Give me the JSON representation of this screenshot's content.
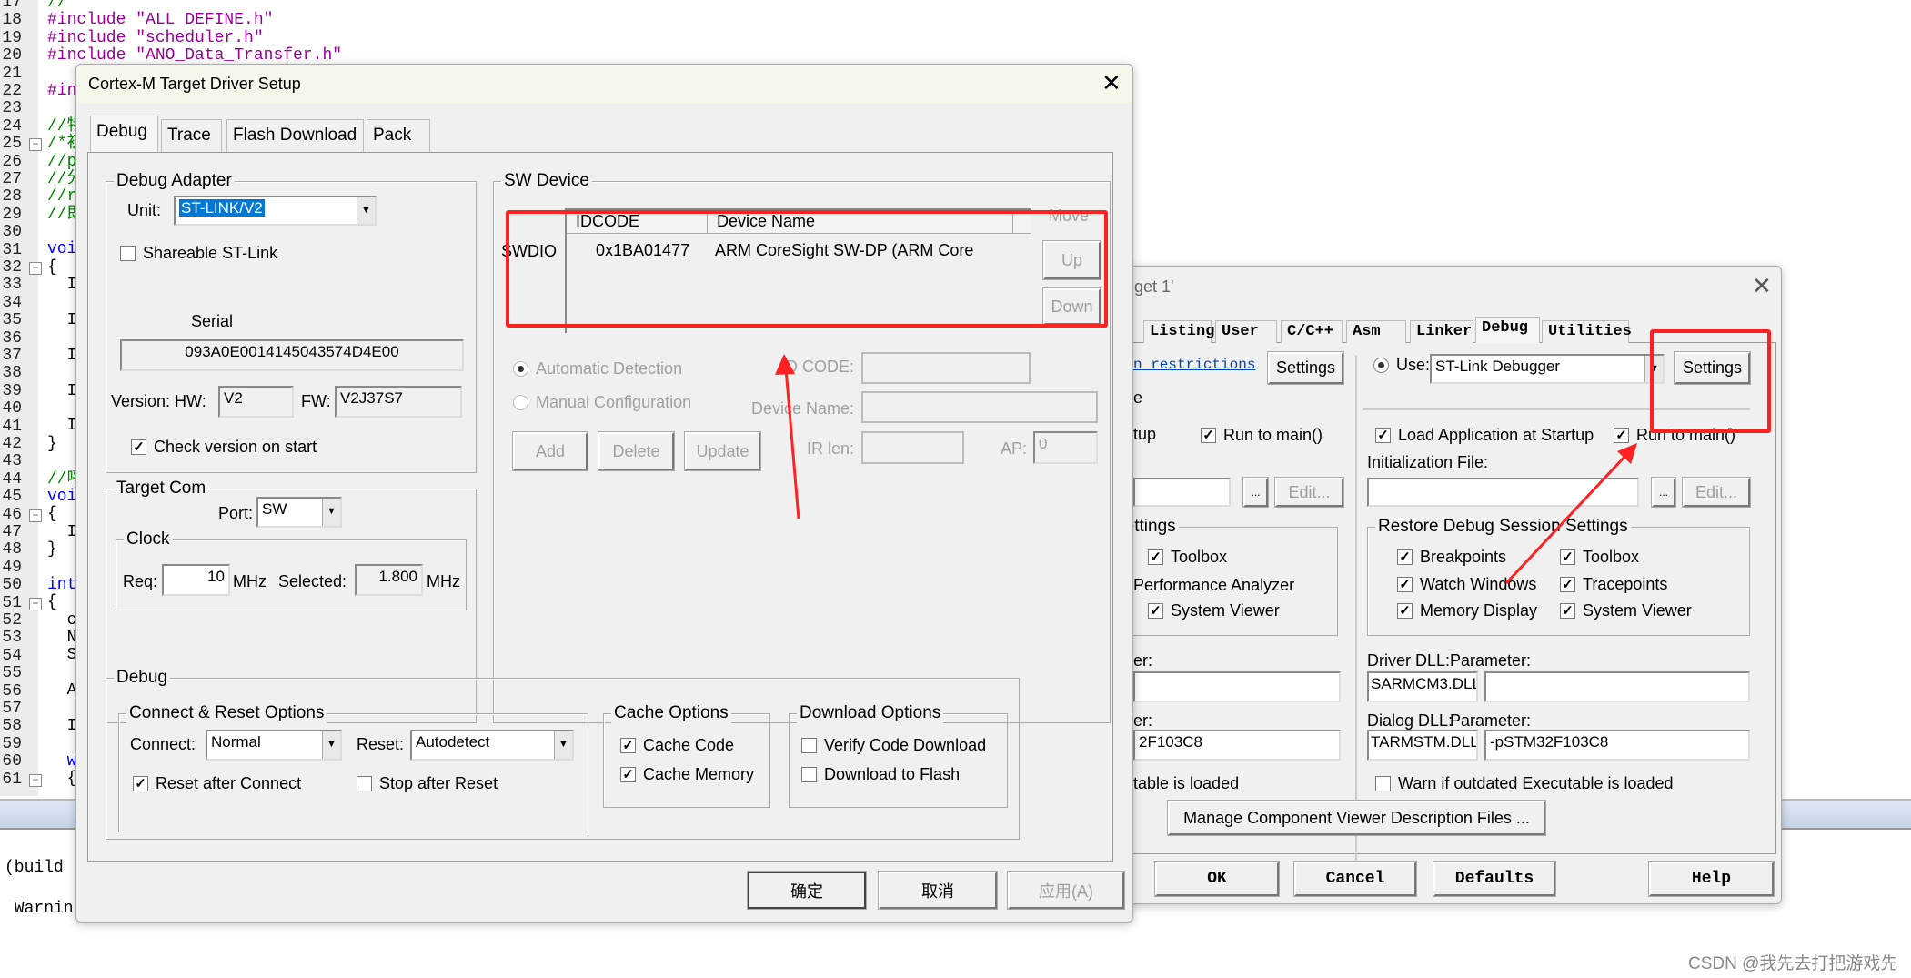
{
  "editor": {
    "lines": [
      {
        "n": "17",
        "t": "//",
        "c": "#080"
      },
      {
        "n": "18",
        "t": "#include \"ALL_DEFINE.h\"",
        "c": "#909"
      },
      {
        "n": "19",
        "t": "#include \"scheduler.h\"",
        "c": "#909"
      },
      {
        "n": "20",
        "t": "#include \"ANO_Data_Transfer.h\"",
        "c": "#909"
      },
      {
        "n": "21",
        "t": "",
        "c": "#000"
      },
      {
        "n": "22",
        "t": "#in",
        "c": "#909"
      },
      {
        "n": "23",
        "t": "",
        "c": "#000"
      },
      {
        "n": "24",
        "t": "//特",
        "c": "#080"
      },
      {
        "n": "25",
        "t": "/*初",
        "c": "#080"
      },
      {
        "n": "26",
        "t": "//p",
        "c": "#080"
      },
      {
        "n": "27",
        "t": "//分",
        "c": "#080"
      },
      {
        "n": "28",
        "t": "//r",
        "c": "#080"
      },
      {
        "n": "29",
        "t": "//即",
        "c": "#080"
      },
      {
        "n": "30",
        "t": "",
        "c": "#000"
      },
      {
        "n": "31",
        "t": "voi",
        "c": "#00f"
      },
      {
        "n": "32",
        "t": "{",
        "c": "#000"
      },
      {
        "n": "33",
        "t": "  I",
        "c": "#000"
      },
      {
        "n": "34",
        "t": "",
        "c": "#000"
      },
      {
        "n": "35",
        "t": "  I",
        "c": "#000"
      },
      {
        "n": "36",
        "t": "",
        "c": "#000"
      },
      {
        "n": "37",
        "t": "  I",
        "c": "#000"
      },
      {
        "n": "38",
        "t": "",
        "c": "#000"
      },
      {
        "n": "39",
        "t": "  I",
        "c": "#000"
      },
      {
        "n": "40",
        "t": "",
        "c": "#000"
      },
      {
        "n": "41",
        "t": "  I",
        "c": "#000"
      },
      {
        "n": "42",
        "t": "}",
        "c": "#000"
      },
      {
        "n": "43",
        "t": "",
        "c": "#000"
      },
      {
        "n": "44",
        "t": "//呼",
        "c": "#080"
      },
      {
        "n": "45",
        "t": "voi",
        "c": "#00f"
      },
      {
        "n": "46",
        "t": "{",
        "c": "#000"
      },
      {
        "n": "47",
        "t": "  I",
        "c": "#000"
      },
      {
        "n": "48",
        "t": "}",
        "c": "#000"
      },
      {
        "n": "49",
        "t": "",
        "c": "#000"
      },
      {
        "n": "50",
        "t": "int",
        "c": "#00f"
      },
      {
        "n": "51",
        "t": "{",
        "c": "#000"
      },
      {
        "n": "52",
        "t": "  c",
        "c": "#000"
      },
      {
        "n": "53",
        "t": "  N",
        "c": "#000"
      },
      {
        "n": "54",
        "t": "  S",
        "c": "#000"
      },
      {
        "n": "55",
        "t": "",
        "c": "#000"
      },
      {
        "n": "56",
        "t": "  A",
        "c": "#000"
      },
      {
        "n": "57",
        "t": "",
        "c": "#000"
      },
      {
        "n": "58",
        "t": "  I",
        "c": "#000"
      },
      {
        "n": "59",
        "t": "",
        "c": "#000"
      },
      {
        "n": "60",
        "t": "  w",
        "c": "#00f"
      },
      {
        "n": "61",
        "t": "  {",
        "c": "#000"
      }
    ]
  },
  "output": {
    "line1": "(build",
    "line2": " Warnin"
  },
  "front": {
    "title": "Cortex-M Target Driver Setup",
    "tabs": [
      "Debug",
      "Trace",
      "Flash Download",
      "Pack"
    ],
    "adapter": {
      "title": "Debug Adapter",
      "unit_label": "Unit:",
      "unit_value": "ST-LINK/V2",
      "shareable": "Shareable ST-Link",
      "serial_label": "Serial",
      "serial": "093A0E0014145043574D4E00",
      "version_label": "Version: HW:",
      "hw": "V2",
      "fw_label": "FW:",
      "fw": "V2J37S7",
      "check_version": "Check version on start"
    },
    "target_com": {
      "title": "Target Com",
      "port_label": "Port:",
      "port": "SW",
      "clock_title": "Clock",
      "req_label": "Req:",
      "req": "10",
      "mhz": "MHz",
      "selected_label": "Selected:",
      "selected": "1.800"
    },
    "sw": {
      "title": "SW Device",
      "swdio": "SWDIO",
      "col_idcode": "IDCODE",
      "col_name": "Device Name",
      "idcode": "0x1BA01477",
      "name": "ARM CoreSight SW-DP (ARM Core",
      "move": "Move",
      "up": "Up",
      "down": "Down",
      "auto": "Automatic Detection",
      "manual": "Manual Configuration",
      "idcode_label": "ID CODE:",
      "devname_label": "Device Name:",
      "irlen_label": "IR len:",
      "ap_label": "AP:",
      "ap": "0",
      "add": "Add",
      "delete": "Delete",
      "update": "Update"
    },
    "debug": {
      "title": "Debug",
      "cr_title": "Connect & Reset Options",
      "connect_label": "Connect:",
      "connect": "Normal",
      "reset_label": "Reset:",
      "reset": "Autodetect",
      "reset_after": "Reset after Connect",
      "stop_after": "Stop after Reset",
      "cache_title": "Cache Options",
      "cache_code": "Cache Code",
      "cache_mem": "Cache Memory",
      "dl_title": "Download Options",
      "verify": "Verify Code Download",
      "dl_flash": "Download to Flash"
    },
    "buttons": {
      "ok": "确定",
      "cancel": "取消",
      "apply": "应用(A)"
    }
  },
  "back": {
    "title": "get 1'",
    "tabs": [
      "Listing",
      "User",
      "C/C++",
      "Asm",
      "Linker",
      "Debug",
      "Utilities"
    ],
    "left": {
      "link": "n restrictions",
      "settings": "Settings",
      "e": "e",
      "tup": "tup",
      "run_main": "Run to main()",
      "dots": "...",
      "edit": "Edit...",
      "settings_grp": "Settings",
      "toolbox": "Toolbox",
      "perf": "Performance Analyzer",
      "sysviewer": "System Viewer",
      "er1": "er:",
      "er2": "er:",
      "param2": "2F103C8",
      "loaded": "table is loaded"
    },
    "right": {
      "use": "Use:",
      "debugger": "ST-Link Debugger",
      "settings": "Settings",
      "load_app": "Load Application at Startup",
      "run_main": "Run to main()",
      "init_file": "Initialization File:",
      "dots": "...",
      "edit": "Edit...",
      "restore": "Restore Debug Session Settings",
      "breakpoints": "Breakpoints",
      "toolbox": "Toolbox",
      "watch": "Watch Windows",
      "tracepoints": "Tracepoints",
      "memory": "Memory Display",
      "sysviewer": "System Viewer",
      "driver_dll": "Driver DLL:",
      "parameter": "Parameter:",
      "driver_val": "SARMCM3.DLL",
      "driver_param": "",
      "dialog_dll": "Dialog DLL:",
      "dialog_val": "TARMSTM.DLL",
      "dialog_param": "-pSTM32F103C8",
      "warn": "Warn if outdated Executable is loaded"
    },
    "manage": "Manage Component Viewer Description Files ...",
    "buttons": {
      "ok": "OK",
      "cancel": "Cancel",
      "defaults": "Defaults",
      "help": "Help"
    }
  },
  "watermark": "CSDN @我先去打把游戏先",
  "colors": {
    "annotation": "#ff2222",
    "selection": "#0078d7",
    "link": "#0645ad"
  }
}
